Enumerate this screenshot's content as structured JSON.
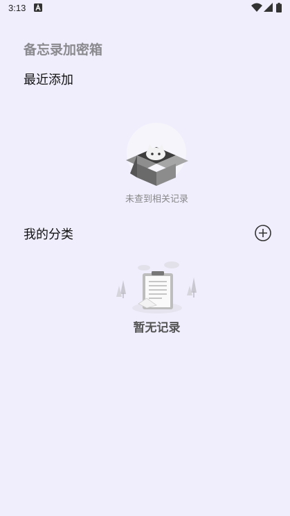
{
  "status_bar": {
    "time": "3:13",
    "icons": [
      "text-a-icon",
      "wifi-icon",
      "signal-icon",
      "battery-icon"
    ]
  },
  "app": {
    "title": "备忘录加密箱"
  },
  "recent": {
    "title": "最近添加",
    "empty_text": "未查到相关记录",
    "empty_icon": "empty-box-icon"
  },
  "categories": {
    "title": "我的分类",
    "add_icon": "add-circle-icon",
    "empty_text": "暂无记录",
    "empty_icon": "empty-document-icon"
  }
}
